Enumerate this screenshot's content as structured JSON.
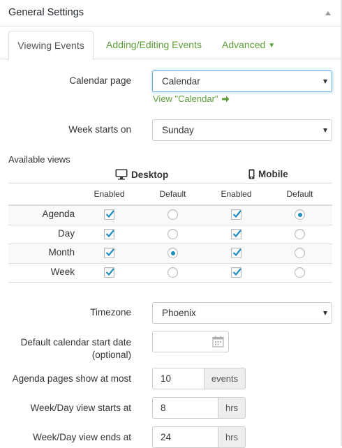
{
  "panel": {
    "title": "General Settings",
    "toggle_icon": "triangle-up-icon"
  },
  "tabs": [
    {
      "label": "Viewing Events",
      "active": true
    },
    {
      "label": "Adding/Editing Events",
      "active": false
    },
    {
      "label": "Advanced",
      "active": false,
      "caret_icon": "caret-down-icon"
    }
  ],
  "calendar_page": {
    "label": "Calendar page",
    "value": "Calendar",
    "link": "View \"Calendar\"",
    "link_icon": "arrow-right-icon"
  },
  "week_starts": {
    "label": "Week starts on",
    "value": "Sunday"
  },
  "views": {
    "section_label": "Available views",
    "desktop_label": "Desktop",
    "mobile_label": "Mobile",
    "columns": [
      "Enabled",
      "Default",
      "Enabled",
      "Default"
    ],
    "rows": [
      {
        "name": "Agenda",
        "desktop_enabled": true,
        "desktop_default": false,
        "mobile_enabled": true,
        "mobile_default": true
      },
      {
        "name": "Day",
        "desktop_enabled": true,
        "desktop_default": false,
        "mobile_enabled": true,
        "mobile_default": false
      },
      {
        "name": "Month",
        "desktop_enabled": true,
        "desktop_default": true,
        "mobile_enabled": true,
        "mobile_default": false
      },
      {
        "name": "Week",
        "desktop_enabled": true,
        "desktop_default": false,
        "mobile_enabled": true,
        "mobile_default": false
      }
    ]
  },
  "timezone": {
    "label": "Timezone",
    "value": "Phoenix"
  },
  "start_date": {
    "label_line1": "Default calendar start date",
    "label_line2": "(optional)",
    "value": "",
    "icon": "calendar-icon"
  },
  "agenda_pages": {
    "label": "Agenda pages show at most",
    "value": "10",
    "unit": "events"
  },
  "week_day_start": {
    "label": "Week/Day view starts at",
    "value": "8",
    "unit": "hrs"
  },
  "week_day_end": {
    "label": "Week/Day view ends at",
    "value": "24",
    "unit": "hrs"
  },
  "colors": {
    "accent_green": "#5c9d39",
    "radio_blue": "#1e8cbe",
    "checkbox_blue": "#1e8cbe",
    "focus_border": "#66afe9"
  }
}
